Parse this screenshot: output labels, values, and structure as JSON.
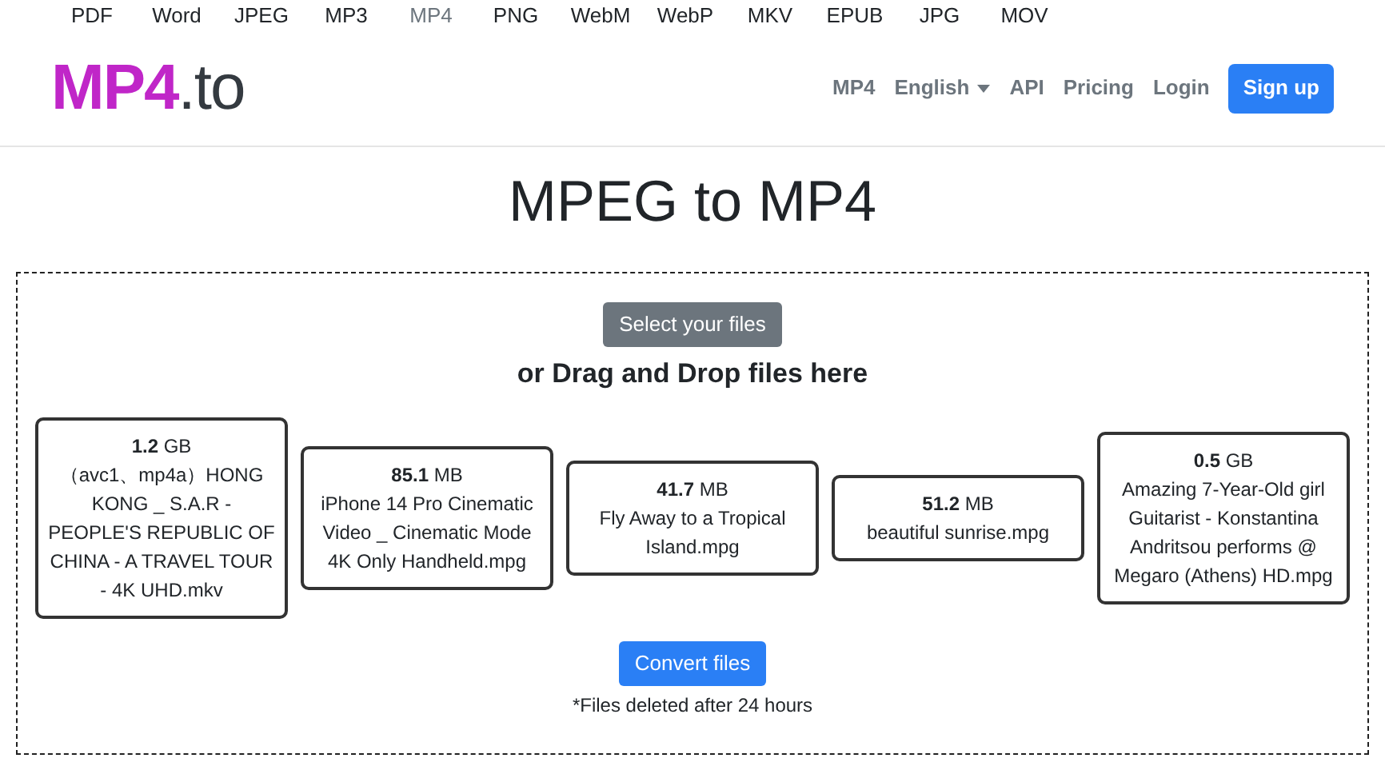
{
  "formats": [
    {
      "label": "PDF",
      "selected": false
    },
    {
      "label": "Word",
      "selected": false
    },
    {
      "label": "JPEG",
      "selected": false
    },
    {
      "label": "MP3",
      "selected": false
    },
    {
      "label": "MP4",
      "selected": true
    },
    {
      "label": "PNG",
      "selected": false
    },
    {
      "label": "WebM",
      "selected": false
    },
    {
      "label": "WebP",
      "selected": false
    },
    {
      "label": "MKV",
      "selected": false
    },
    {
      "label": "EPUB",
      "selected": false
    },
    {
      "label": "JPG",
      "selected": false
    },
    {
      "label": "MOV",
      "selected": false
    }
  ],
  "logo": {
    "brand": "MP4",
    "suffix": ".to"
  },
  "nav": [
    {
      "label": "MP4",
      "kind": "link"
    },
    {
      "label": "English",
      "kind": "dropdown"
    },
    {
      "label": "API",
      "kind": "link"
    },
    {
      "label": "Pricing",
      "kind": "link"
    },
    {
      "label": "Login",
      "kind": "link"
    },
    {
      "label": "Sign up",
      "kind": "button"
    }
  ],
  "title": "MPEG to MP4",
  "upload": {
    "button": "Select your files",
    "hint": "or Drag and Drop files here"
  },
  "files": [
    {
      "size": "**1.2** GB",
      "name": "（avc1、mp4a）HONG KONG _ S.A.R - PEOPLE'S REPUBLIC OF CHINA - A TRAVEL TOUR - 4K UHD.mkv"
    },
    {
      "size": "**85.1** MB",
      "name": "iPhone 14 Pro Cinematic Video _ Cinematic Mode 4K Only Handheld.mpg"
    },
    {
      "size": "**41.7** MB",
      "name": "Fly Away to a Tropical Island.mpg"
    },
    {
      "size": "**51.2** MB",
      "name": "beautiful sunrise.mpg"
    },
    {
      "size": "**0.5** GB",
      "name": "Amazing 7-Year-Old girl Guitarist - Konstantina Andritsou performs @ Megaro (Athens) HD.mpg"
    }
  ],
  "convert": {
    "button": "Convert files",
    "note": "*Files deleted after 24 hours"
  }
}
